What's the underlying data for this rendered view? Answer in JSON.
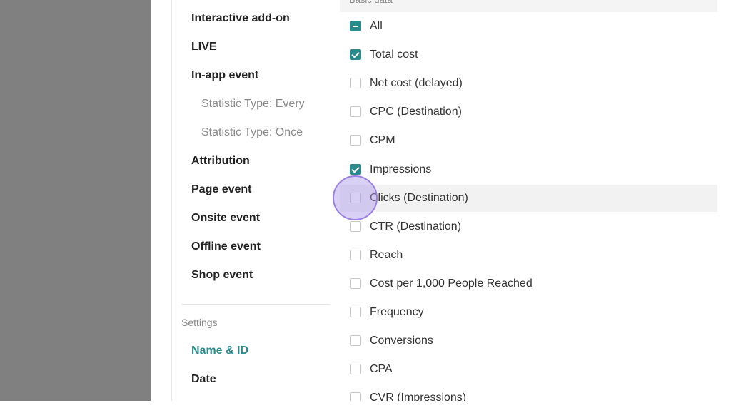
{
  "sidebar": {
    "items": [
      {
        "label": "Interactive add-on",
        "kind": "main"
      },
      {
        "label": "LIVE",
        "kind": "main"
      },
      {
        "label": "In-app event",
        "kind": "main"
      },
      {
        "label": "Statistic Type: Every",
        "kind": "sub"
      },
      {
        "label": "Statistic Type: Once",
        "kind": "sub"
      },
      {
        "label": "Attribution",
        "kind": "main"
      },
      {
        "label": "Page event",
        "kind": "main"
      },
      {
        "label": "Onsite event",
        "kind": "main"
      },
      {
        "label": "Offline event",
        "kind": "main"
      },
      {
        "label": "Shop event",
        "kind": "main"
      }
    ],
    "settings_label": "Settings",
    "settings_items": [
      {
        "label": "Name & ID",
        "active": true
      },
      {
        "label": "Date",
        "active": false
      }
    ]
  },
  "metrics": {
    "section_header": "Basic data",
    "rows": [
      {
        "label": "All",
        "state": "indeterminate"
      },
      {
        "label": "Total cost",
        "state": "checked"
      },
      {
        "label": "Net cost (delayed)",
        "state": "unchecked"
      },
      {
        "label": "CPC (Destination)",
        "state": "unchecked"
      },
      {
        "label": "CPM",
        "state": "unchecked"
      },
      {
        "label": "Impressions",
        "state": "checked"
      },
      {
        "label": "Clicks (Destination)",
        "state": "unchecked",
        "hovered": true
      },
      {
        "label": "CTR (Destination)",
        "state": "unchecked"
      },
      {
        "label": "Reach",
        "state": "unchecked"
      },
      {
        "label": "Cost per 1,000 People Reached",
        "state": "unchecked"
      },
      {
        "label": "Frequency",
        "state": "unchecked"
      },
      {
        "label": "Conversions",
        "state": "unchecked"
      },
      {
        "label": "CPA",
        "state": "unchecked"
      },
      {
        "label": "CVR (Impressions)",
        "state": "unchecked"
      }
    ]
  },
  "colors": {
    "accent": "#2a8a8c",
    "backdrop": "#808080",
    "cursor": "#9a7fe6"
  }
}
